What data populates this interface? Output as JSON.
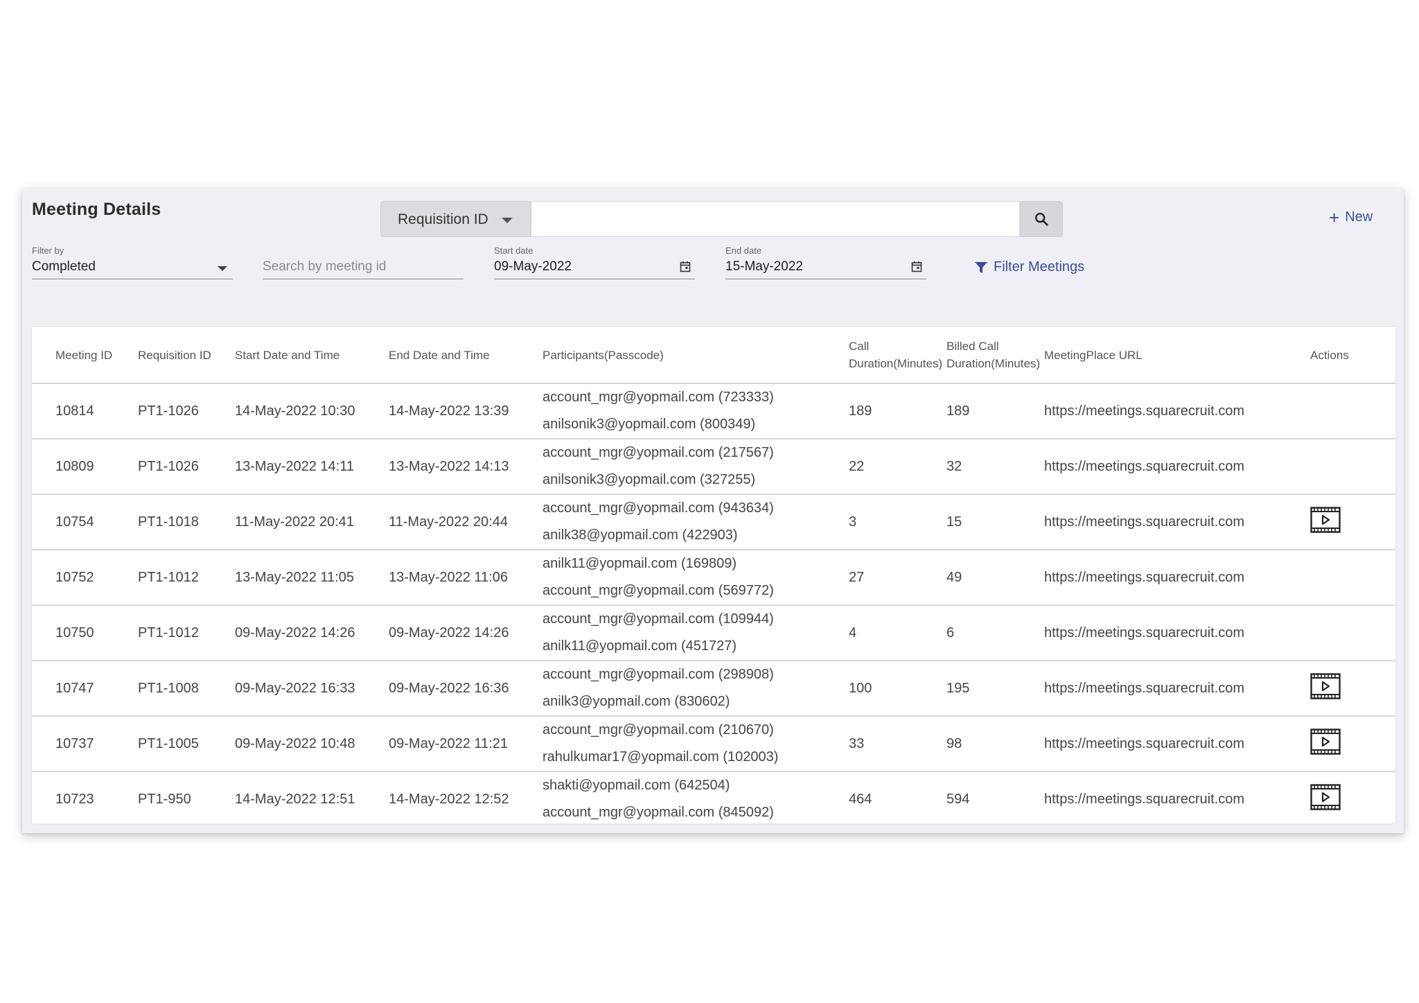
{
  "header": {
    "title": "Meeting Details",
    "new_label": "New"
  },
  "search": {
    "select_label": "Requisition ID",
    "value": "",
    "search_icon": "search-icon"
  },
  "filters": {
    "filter_by": {
      "label": "Filter by",
      "value": "Completed"
    },
    "meeting_search": {
      "placeholder": "Search by meeting id"
    },
    "start_date": {
      "label": "Start date",
      "value": "09-May-2022"
    },
    "end_date": {
      "label": "End date",
      "value": "15-May-2022"
    },
    "filter_button_label": "Filter Meetings"
  },
  "colors": {
    "accent": "#3d4f9f",
    "panel_bg": "#eff0f6"
  },
  "table": {
    "headers": {
      "meeting_id": "Meeting ID",
      "requisition_id": "Requisition ID",
      "start": "Start Date and Time",
      "end": "End Date and Time",
      "participants": "Participants(Passcode)",
      "call_duration_1": "Call",
      "call_duration_2": "Duration(Minutes)",
      "billed_1": "Billed Call",
      "billed_2": "Duration(Minutes)",
      "url": "MeetingPlace URL",
      "actions": "Actions"
    },
    "rows": [
      {
        "meeting_id": "10814",
        "requisition_id": "PT1-1026",
        "start": "14-May-2022 10:30",
        "end": "14-May-2022 13:39",
        "participants": [
          "account_mgr@yopmail.com (723333)",
          "anilsonik3@yopmail.com (800349)"
        ],
        "call_duration": "189",
        "billed_duration": "189",
        "url": "https://meetings.squarecruit.com",
        "has_recording": false
      },
      {
        "meeting_id": "10809",
        "requisition_id": "PT1-1026",
        "start": "13-May-2022 14:11",
        "end": "13-May-2022 14:13",
        "participants": [
          "account_mgr@yopmail.com (217567)",
          "anilsonik3@yopmail.com (327255)"
        ],
        "call_duration": "22",
        "billed_duration": "32",
        "url": "https://meetings.squarecruit.com",
        "has_recording": false
      },
      {
        "meeting_id": "10754",
        "requisition_id": "PT1-1018",
        "start": "11-May-2022 20:41",
        "end": "11-May-2022 20:44",
        "participants": [
          "account_mgr@yopmail.com (943634)",
          "anilk38@yopmail.com (422903)"
        ],
        "call_duration": "3",
        "billed_duration": "15",
        "url": "https://meetings.squarecruit.com",
        "has_recording": true
      },
      {
        "meeting_id": "10752",
        "requisition_id": "PT1-1012",
        "start": "13-May-2022 11:05",
        "end": "13-May-2022 11:06",
        "participants": [
          "anilk11@yopmail.com (169809)",
          "account_mgr@yopmail.com (569772)"
        ],
        "call_duration": "27",
        "billed_duration": "49",
        "url": "https://meetings.squarecruit.com",
        "has_recording": false
      },
      {
        "meeting_id": "10750",
        "requisition_id": "PT1-1012",
        "start": "09-May-2022 14:26",
        "end": "09-May-2022 14:26",
        "participants": [
          "account_mgr@yopmail.com (109944)",
          "anilk11@yopmail.com (451727)"
        ],
        "call_duration": "4",
        "billed_duration": "6",
        "url": "https://meetings.squarecruit.com",
        "has_recording": false
      },
      {
        "meeting_id": "10747",
        "requisition_id": "PT1-1008",
        "start": "09-May-2022 16:33",
        "end": "09-May-2022 16:36",
        "participants": [
          "account_mgr@yopmail.com (298908)",
          "anilk3@yopmail.com (830602)"
        ],
        "call_duration": "100",
        "billed_duration": "195",
        "url": "https://meetings.squarecruit.com",
        "has_recording": true
      },
      {
        "meeting_id": "10737",
        "requisition_id": "PT1-1005",
        "start": "09-May-2022 10:48",
        "end": "09-May-2022 11:21",
        "participants": [
          "account_mgr@yopmail.com (210670)",
          "rahulkumar17@yopmail.com (102003)"
        ],
        "call_duration": "33",
        "billed_duration": "98",
        "url": "https://meetings.squarecruit.com",
        "has_recording": true
      },
      {
        "meeting_id": "10723",
        "requisition_id": "PT1-950",
        "start": "14-May-2022 12:51",
        "end": "14-May-2022 12:52",
        "participants": [
          "shakti@yopmail.com (642504)",
          "account_mgr@yopmail.com (845092)"
        ],
        "call_duration": "464",
        "billed_duration": "594",
        "url": "https://meetings.squarecruit.com",
        "has_recording": true
      }
    ]
  }
}
